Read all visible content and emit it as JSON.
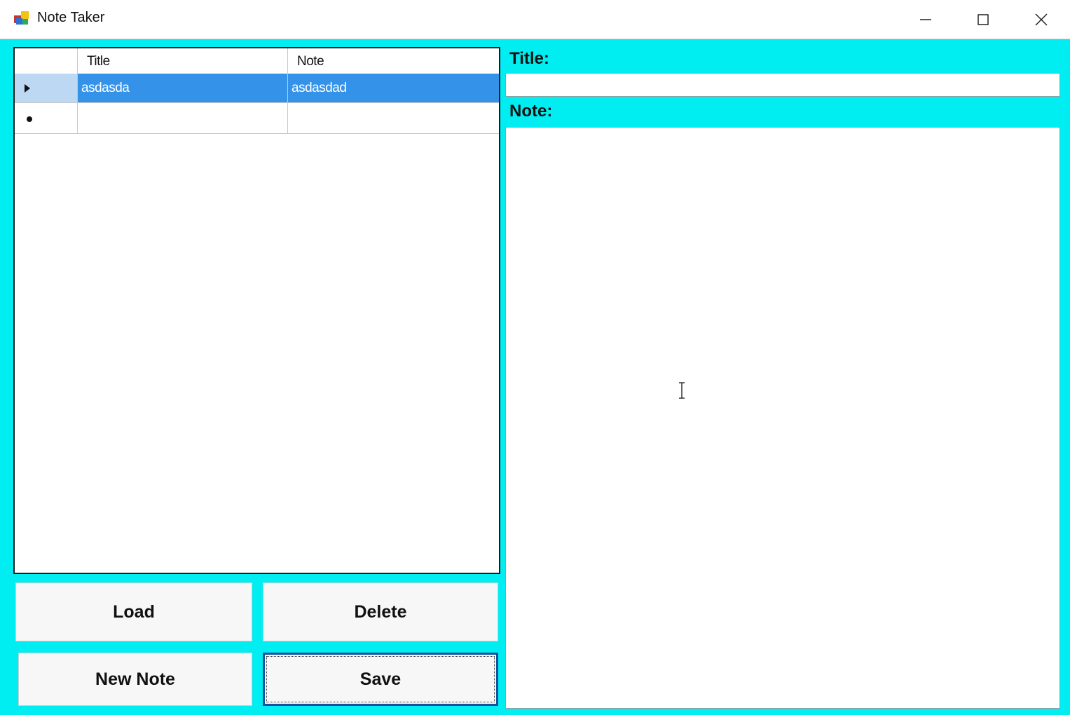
{
  "window": {
    "title": "Note Taker",
    "icons": {
      "app": "app-icon",
      "minimize": "minimize-icon",
      "maximize": "maximize-icon",
      "close": "close-icon"
    }
  },
  "grid": {
    "columns": [
      "Title",
      "Note"
    ],
    "rows": [
      {
        "title": "asdasda",
        "note": "asdasdad",
        "selected": true,
        "marker": "current-row-arrow-icon"
      },
      {
        "title": "",
        "note": "",
        "selected": false,
        "marker": "new-row-asterisk-icon"
      }
    ]
  },
  "buttons": {
    "load": "Load",
    "delete": "Delete",
    "new_note": "New Note",
    "save": "Save"
  },
  "editor": {
    "title_label": "Title:",
    "title_value": "",
    "note_label": "Note:",
    "note_value": ""
  },
  "colors": {
    "form_background": "#00eef2",
    "selection": "#3492e8"
  }
}
